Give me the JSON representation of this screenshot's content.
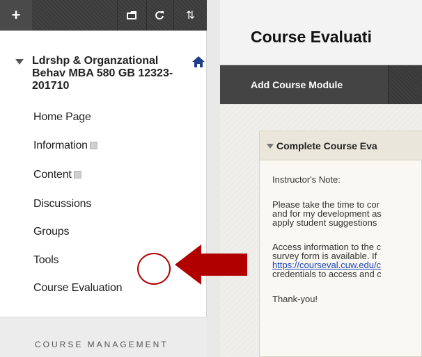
{
  "sidebar": {
    "toolbar": {
      "add_icon": "plus-icon",
      "folder_icon": "folder-icon",
      "refresh_icon": "refresh-icon",
      "sort_icon": "sort-icon"
    },
    "course_title": "Ldrshp & Organzational Behav MBA 580 GB 12323-201710",
    "items": [
      {
        "label": "Home Page",
        "has_mini": false
      },
      {
        "label": "Information",
        "has_mini": true
      },
      {
        "label": "Content",
        "has_mini": true
      },
      {
        "label": "Discussions",
        "has_mini": false
      },
      {
        "label": "Groups",
        "has_mini": false
      },
      {
        "label": "Tools",
        "has_mini": false
      },
      {
        "label": "Course Evaluation",
        "has_mini": false
      }
    ],
    "course_management": "COURSE MANAGEMENT"
  },
  "main": {
    "page_title": "Course Evaluati",
    "add_module": "Add Course Module",
    "module": {
      "title": "Complete Course Eva",
      "lines": [
        "Instructor's Note:",
        "Please take the time to cor",
        "and for my development as",
        "apply student suggestions",
        "Access information to the c",
        "survey form is available. If",
        "https://courseval.cuw.edu/c",
        "credentials to access and c",
        "Thank-you!"
      ]
    }
  },
  "colors": {
    "annotation_red": "#b00000",
    "link_blue": "#1a44b8",
    "toolbar_dark": "#3d3d3d"
  }
}
